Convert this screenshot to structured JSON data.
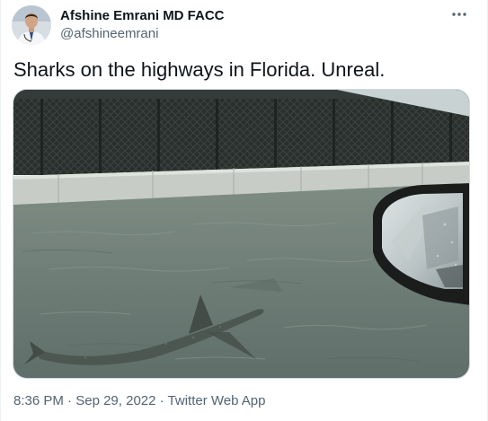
{
  "author": {
    "name": "Afshine Emrani MD FACC",
    "handle": "@afshineemrani"
  },
  "tweet": {
    "text": "Sharks on the highways in Florida. Unreal."
  },
  "meta": {
    "time": "8:36 PM",
    "date": "Sep 29, 2022",
    "source": "Twitter Web App",
    "separator": "·"
  },
  "icons": {
    "more": "more-horizontal-icon",
    "avatar": "user-avatar"
  },
  "colors": {
    "text_primary": "#0f1419",
    "text_secondary": "#536471",
    "border": "#cfd9de"
  }
}
